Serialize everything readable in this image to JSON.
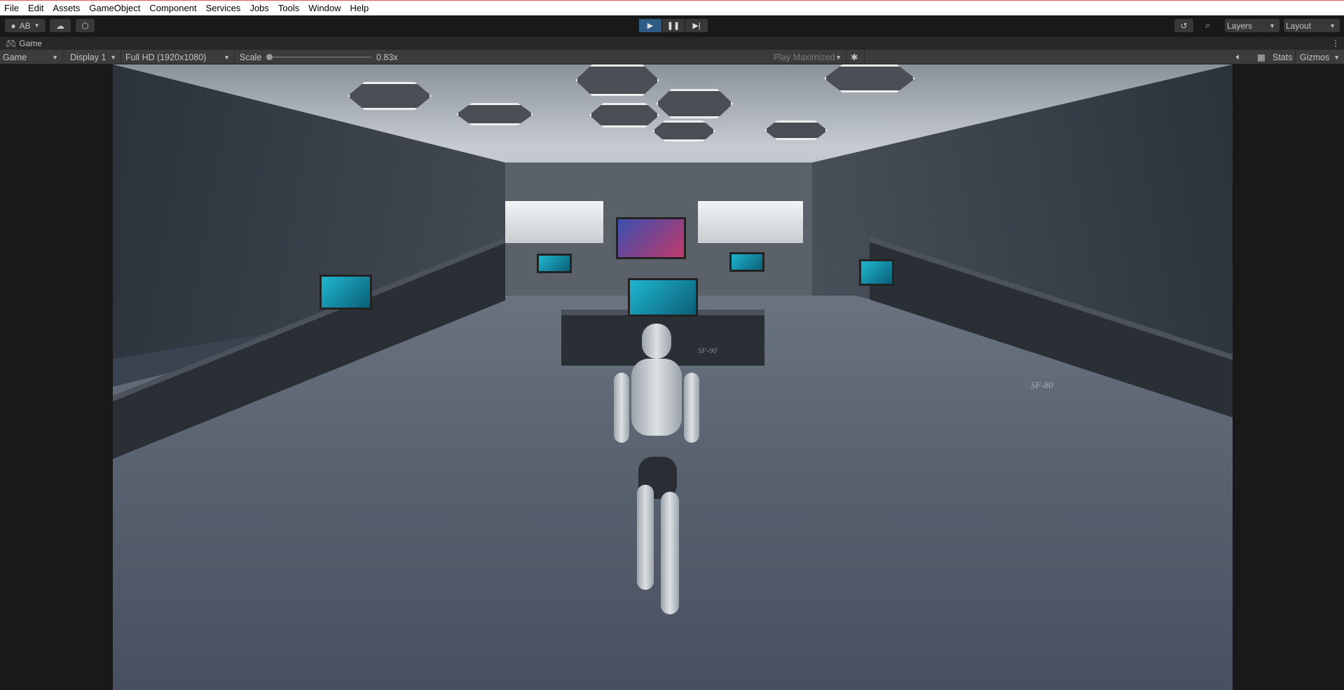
{
  "menu": [
    "File",
    "Edit",
    "Assets",
    "GameObject",
    "Component",
    "Services",
    "Jobs",
    "Tools",
    "Window",
    "Help"
  ],
  "toolbar": {
    "account": "AB",
    "layers": "Layers",
    "layout": "Layout"
  },
  "tab": {
    "title": "Game"
  },
  "game_toolbar": {
    "mode": "Game",
    "display": "Display 1",
    "resolution": "Full HD (1920x1080)",
    "scale_label": "Scale",
    "scale_value": "0.83x",
    "play_mode": "Play Maximized",
    "stats": "Stats",
    "gizmos": "Gizmos"
  },
  "scene": {
    "labels": [
      "SF-80",
      "SF-90"
    ]
  },
  "colors": {
    "play_active": "#2e5a86",
    "panel": "#3c3c3c",
    "toolbar": "#191919"
  }
}
